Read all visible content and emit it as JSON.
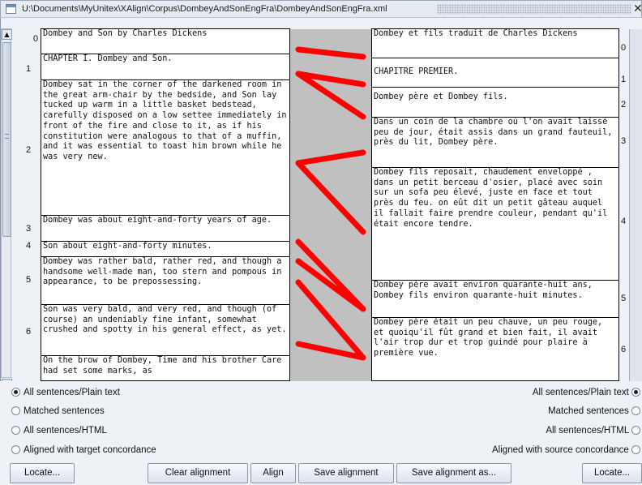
{
  "window": {
    "title": "U:\\Documents\\MyUnitex\\XAlign\\Corpus\\DombeyAndSonEngFra\\DombeyAndSonEngFra.xml",
    "close_glyph": "✕"
  },
  "source": {
    "sentences": [
      {
        "index": "0",
        "text": "Dombey and Son by Charles Dickens"
      },
      {
        "index": "1",
        "text": "CHAPTER I. Dombey and Son."
      },
      {
        "index": "2",
        "text": "Dombey sat in the corner of the darkened room in the great arm-chair by the bedside, and Son lay tucked up warm in a little basket bedstead, carefully disposed on a low settee immediately in front of the fire and close to it, as if his constitution were analogous to that of a muffin, and it was essential to toast him brown while he was very new."
      },
      {
        "index": "3",
        "text": "Dombey was about eight-and-forty years of age."
      },
      {
        "index": "4",
        "text": "Son about eight-and-forty minutes."
      },
      {
        "index": "5",
        "text": "Dombey was rather bald, rather red, and though a handsome well-made man, too stern and pompous in appearance, to be prepossessing."
      },
      {
        "index": "6",
        "text": "Son was very bald, and very red, and though (of course) an undeniably fine infant, somewhat crushed and spotty in his general effect, as yet."
      },
      {
        "index": "",
        "text": "On the brow of Dombey, Time and his brother Care had set some marks, as"
      }
    ]
  },
  "target": {
    "sentences": [
      {
        "index": "0",
        "text": "Dombey et fils traduit de Charles Dickens"
      },
      {
        "index": "1",
        "text": "CHAPITRE PREMIER."
      },
      {
        "index": "2",
        "text": "Dombey père et Dombey fils."
      },
      {
        "index": "3",
        "text": "Dans un coin de la chambre où l'on avait laissé peu de jour, était assis dans un grand fauteuil, près du lit, Dombey père."
      },
      {
        "index": "4",
        "text": "Dombey fils reposait, chaudement enveloppé , dans un petit berceau d'osier, placé avec soin sur un sofa peu élevé, juste en face et tout près du feu. on eût dit un petit gâteau auquel il fallait faire prendre couleur, pendant qu'il était encore tendre."
      },
      {
        "index": "5",
        "text": "Dombey père avait environ quarante-huit ans, Dombey fils environ quarante-huit minutes."
      },
      {
        "index": "6",
        "text": "Dombey père était un peu chauve, un peu rouge, et quoiqu'il fût grand et bien fait, il avait l'air trop dur et trop guindé pour plaire à première vue."
      }
    ]
  },
  "links": [
    [
      0,
      0
    ],
    [
      1,
      1
    ],
    [
      1,
      2
    ],
    [
      2,
      3
    ],
    [
      2,
      4
    ],
    [
      3,
      5
    ],
    [
      4,
      5
    ],
    [
      5,
      6
    ],
    [
      6,
      6
    ]
  ],
  "link_color": "#ff0000",
  "options": {
    "left": [
      {
        "label": "All sentences/Plain text",
        "checked": true
      },
      {
        "label": "Matched sentences",
        "checked": false
      },
      {
        "label": "All sentences/HTML",
        "checked": false
      },
      {
        "label": "Aligned with target concordance",
        "checked": false
      }
    ],
    "right": [
      {
        "label": "All sentences/Plain text",
        "checked": true
      },
      {
        "label": "Matched sentences",
        "checked": false
      },
      {
        "label": "All sentences/HTML",
        "checked": false
      },
      {
        "label": "Aligned with source concordance",
        "checked": false
      }
    ]
  },
  "buttons": {
    "locate_left": "Locate...",
    "clear_alignment": "Clear alignment",
    "align": "Align",
    "save_alignment": "Save alignment",
    "save_alignment_as": "Save alignment as...",
    "locate_right": "Locate..."
  }
}
